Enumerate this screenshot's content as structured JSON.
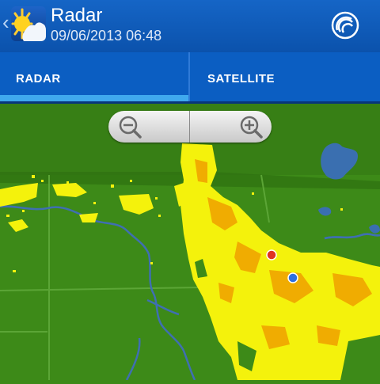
{
  "app": {
    "title": "Radar",
    "timestamp": "09/06/2013 06:48",
    "back_icon": "chevron-left-icon",
    "app_icon": "sun-icon",
    "action_icon": "radar-signal-icon"
  },
  "tabs": [
    {
      "label": "RADAR",
      "selected": true
    },
    {
      "label": "SATELLITE",
      "selected": false
    }
  ],
  "zoom": {
    "out_icon": "zoom-out-icon",
    "in_icon": "zoom-in-icon"
  },
  "colors": {
    "app_bar": "#0b52ac",
    "tab_indicator": "#3fa9ee",
    "land": "#3d8a18",
    "water": "#3a6fb0",
    "precip_light": "#f4f20c",
    "precip_moderate": "#f0a000",
    "marker_red": "#e03322",
    "marker_blue": "#2f6fe0"
  }
}
